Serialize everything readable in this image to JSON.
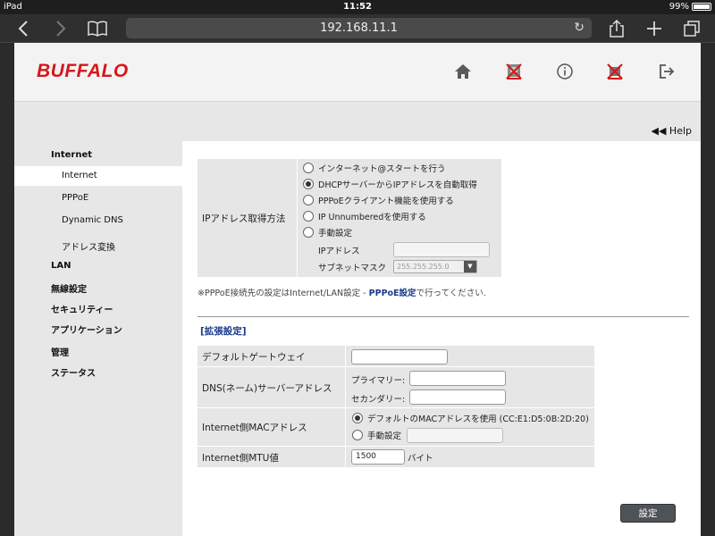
{
  "status_bar": {
    "device": "iPad",
    "time": "11:52",
    "battery": "99%"
  },
  "browser": {
    "url": "192.168.11.1"
  },
  "header": {
    "logo": "BUFFALO"
  },
  "help": {
    "label": "Help"
  },
  "sidebar": {
    "items": [
      {
        "label": "Internet"
      },
      {
        "label": "Internet"
      },
      {
        "label": "PPPoE"
      },
      {
        "label": "Dynamic DNS"
      },
      {
        "label": "アドレス変換"
      },
      {
        "label": "LAN"
      },
      {
        "label": "無線設定"
      },
      {
        "label": "セキュリティー"
      },
      {
        "label": "アプリケーション"
      },
      {
        "label": "管理"
      },
      {
        "label": "ステータス"
      }
    ]
  },
  "ip_method": {
    "label": "IPアドレス取得方法",
    "options": [
      {
        "label": "インターネット@スタートを行う",
        "selected": false
      },
      {
        "label": "DHCPサーバーからIPアドレスを自動取得",
        "selected": true
      },
      {
        "label": "PPPoEクライアント機能を使用する",
        "selected": false
      },
      {
        "label": "IP Unnumberedを使用する",
        "selected": false
      },
      {
        "label": "手動設定",
        "selected": false
      }
    ],
    "ip_address_label": "IPアドレス",
    "ip_address_value": "",
    "subnet_label": "サブネットマスク",
    "subnet_value": "255.255.255.0"
  },
  "note": {
    "prefix": "※PPPoE接続先の設定はInternet/LAN設定 - ",
    "link": "PPPoE設定",
    "suffix": "で行ってください."
  },
  "extended": {
    "title": "[拡張設定]",
    "gateway_label": "デフォルトゲートウェイ",
    "gateway_value": "",
    "dns_label": "DNS(ネーム)サーバーアドレス",
    "dns_primary_label": "プライマリー:",
    "dns_primary_value": "",
    "dns_secondary_label": "セカンダリー:",
    "dns_secondary_value": "",
    "mac_label": "Internet側MACアドレス",
    "mac_default_label": "デフォルトのMACアドレスを使用 (CC:E1:D5:0B:2D:20)",
    "mac_manual_label": "手動設定",
    "mac_manual_value": "",
    "mtu_label": "Internet側MTU値",
    "mtu_value": "1500",
    "mtu_unit": "バイト"
  },
  "submit_label": "設定"
}
